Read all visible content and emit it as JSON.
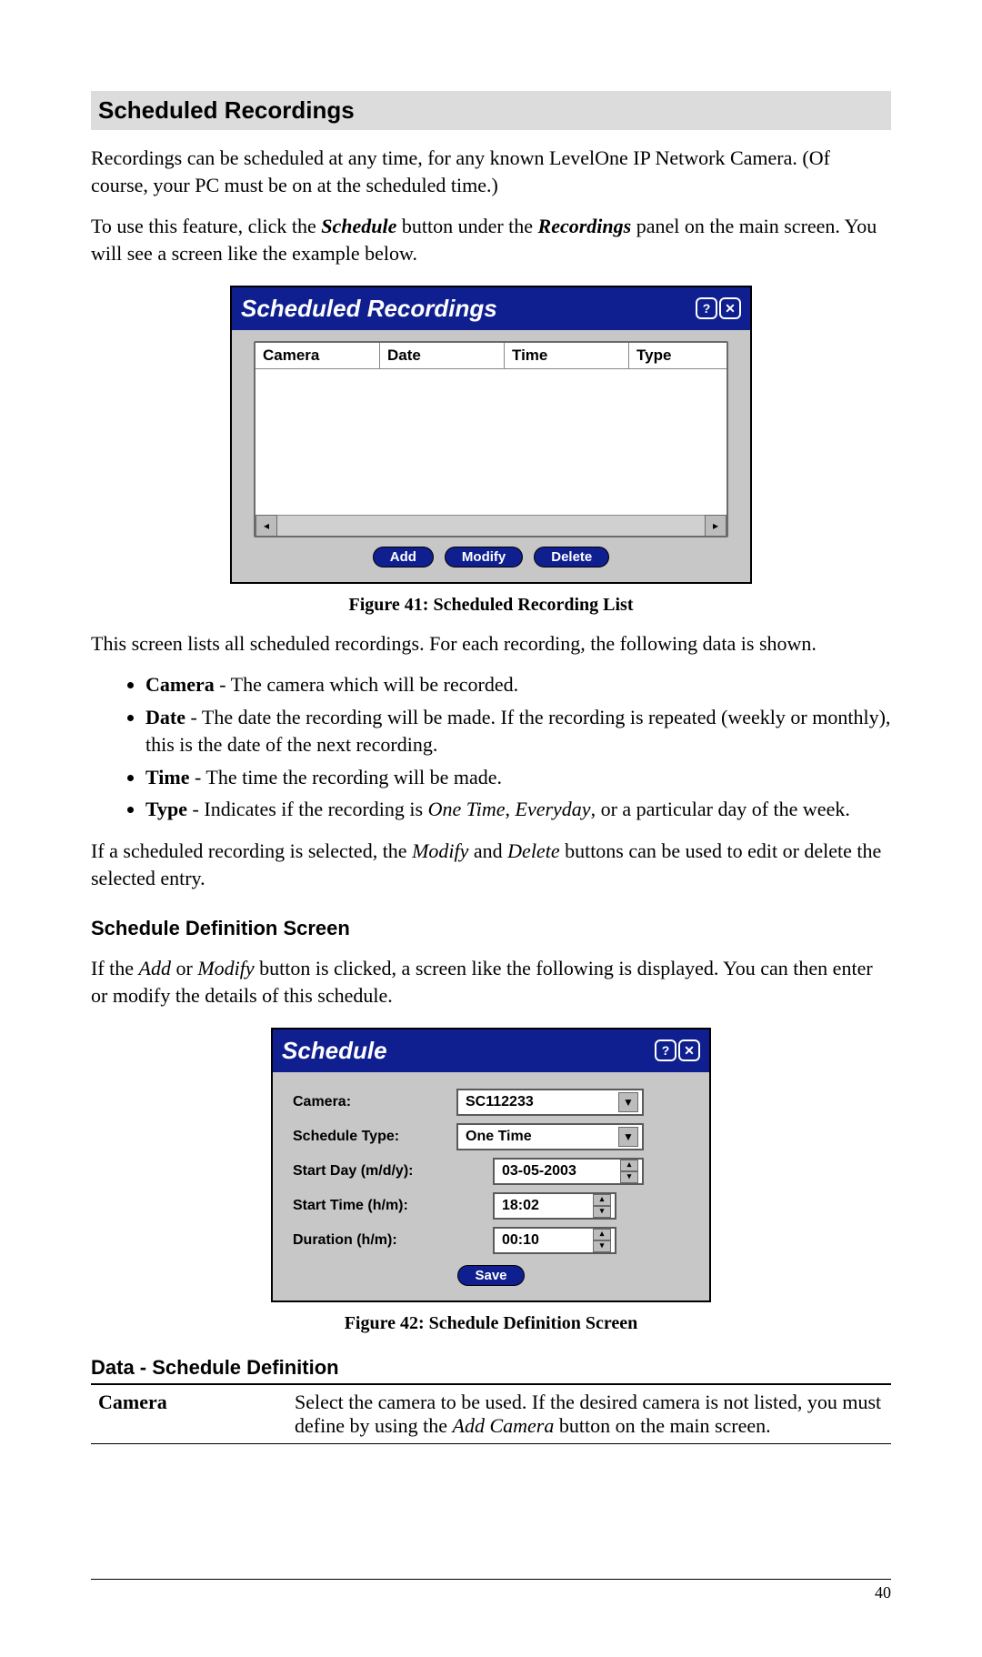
{
  "section_title": "Scheduled Recordings",
  "para1": "Recordings can be scheduled at any time, for any known LevelOne IP Network Camera. (Of course, your PC must be on at the scheduled time.)",
  "para2_a": "To use this feature, click the ",
  "para2_b": "Schedule",
  "para2_c": " button under the ",
  "para2_d": "Recordings",
  "para2_e": " panel on the main screen. You will see a screen like the example below.",
  "dlg1": {
    "title": "Scheduled Recordings",
    "help": "?",
    "close": "✕",
    "columns": {
      "camera": "Camera",
      "date": "Date",
      "time": "Time",
      "type": "Type"
    },
    "scroll_left": "◂",
    "scroll_right": "▸",
    "add": "Add",
    "modify": "Modify",
    "delete": "Delete"
  },
  "fig1_caption": "Figure 41: Scheduled Recording List",
  "para3": "This screen lists all scheduled recordings. For each recording, the following data is shown.",
  "bullets": {
    "camera_label": "Camera",
    "camera_text": " - The camera which will be recorded.",
    "date_label": "Date",
    "date_text": " - The date the recording will be made. If the recording is repeated (weekly or monthly), this is the date of the next recording.",
    "time_label": "Time",
    "time_text": " - The time the recording will be made.",
    "type_label": "Type",
    "type_text_a": " - Indicates if the recording is ",
    "type_text_b": "One Time",
    "type_text_c": ", ",
    "type_text_d": "Everyday",
    "type_text_e": ", or a particular day of the week."
  },
  "para4_a": "If a scheduled recording is selected, the ",
  "para4_b": "Modify",
  "para4_c": " and ",
  "para4_d": "Delete",
  "para4_e": " buttons can be used to edit or delete the selected entry.",
  "sub_heading": "Schedule Definition Screen",
  "para5_a": "If the ",
  "para5_b": "Add",
  "para5_c": " or ",
  "para5_d": "Modify",
  "para5_e": " button is clicked, a screen like the following is displayed. You can then enter or modify the details of this schedule.",
  "dlg2": {
    "title": "Schedule",
    "help": "?",
    "close": "✕",
    "labels": {
      "camera": "Camera:",
      "schedule_type": "Schedule Type:",
      "start_day": "Start Day (m/d/y):",
      "start_time": "Start Time (h/m):",
      "duration": "Duration (h/m):"
    },
    "values": {
      "camera": "SC112233",
      "schedule_type": "One Time",
      "start_day": "03-05-2003",
      "start_time": "18:02",
      "duration": "00:10"
    },
    "caret": "▼",
    "spin_up": "▴",
    "spin_down": "▾",
    "save": "Save"
  },
  "fig2_caption": "Figure 42: Schedule Definition Screen",
  "data_heading": "Data - Schedule Definition",
  "defn_row": {
    "key": "Camera",
    "val_a": "Select the camera to be used. If the desired camera is not listed, you must define by using the ",
    "val_b": "Add Camera",
    "val_c": " button on the main screen."
  },
  "page_number": "40"
}
